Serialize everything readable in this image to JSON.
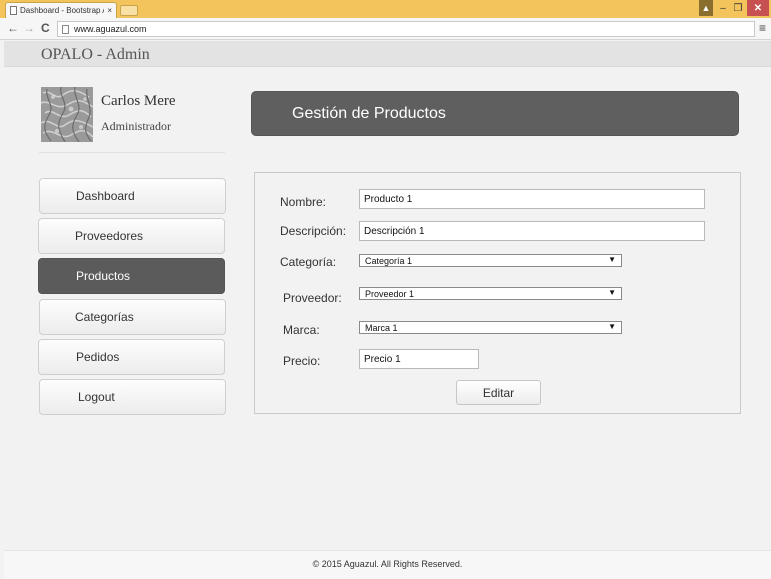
{
  "browser": {
    "tab_title": "Dashboard - Bootstrap Ad",
    "url": "www.aguazul.com",
    "close_glyph": "×"
  },
  "app": {
    "brand": "OPALO - Admin"
  },
  "user": {
    "name": "Carlos Mere",
    "role": "Administrador"
  },
  "sidebar": {
    "items": [
      {
        "label": "Dashboard"
      },
      {
        "label": "Proveedores"
      },
      {
        "label": "Productos"
      },
      {
        "label": "Categorías"
      },
      {
        "label": "Pedidos"
      },
      {
        "label": "Logout"
      }
    ],
    "active": "Productos"
  },
  "main": {
    "title": "Gestión de Productos",
    "form": {
      "nombre_label": "Nombre:",
      "nombre_value": "Producto 1",
      "descripcion_label": "Descripción:",
      "descripcion_value": "Descripción 1",
      "categoria_label": "Categoría:",
      "categoria_value": "Categoría 1",
      "proveedor_label": "Proveedor:",
      "proveedor_value": "Proveedor 1",
      "marca_label": "Marca:",
      "marca_value": "Marca 1",
      "precio_label": "Precio:",
      "precio_value": "Precio 1",
      "submit_label": "Editar"
    }
  },
  "footer": {
    "text": "© 2015 Aguazul. All Rights Reserved."
  },
  "colors": {
    "chrome_accent": "#f3c35c",
    "header_bg": "#5f5f5f",
    "active_item_bg": "#5b5b5b"
  }
}
